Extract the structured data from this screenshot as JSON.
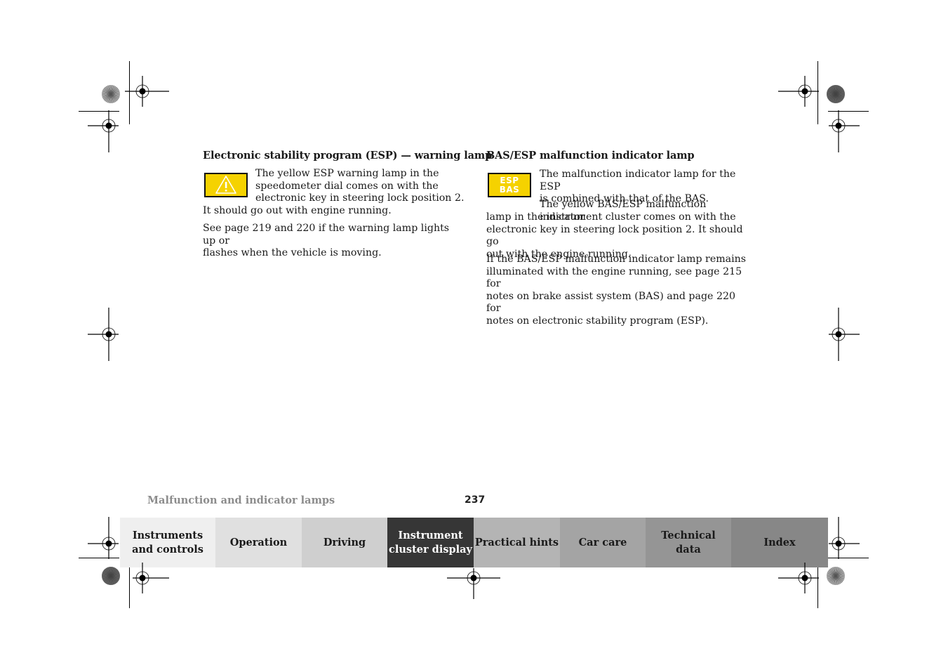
{
  "left_section": {
    "heading": "Electronic stability program (ESP) — warning lamp",
    "icon": "warning-triangle-icon",
    "lines_beside_icon": [
      "The yellow ESP warning lamp in the",
      "speedometer dial comes on with the",
      "electronic key in steering lock position 2."
    ],
    "line_after_icon": "It should go out with engine running.",
    "paragraph2": [
      "See page 219 and 220 if the warning lamp lights up or",
      "flashes when the vehicle is moving."
    ]
  },
  "right_section": {
    "heading": "BAS/ESP malfunction indicator lamp",
    "icon": "esp-bas-lamp-icon",
    "icon_text": [
      "ESP",
      "BAS"
    ],
    "lines_beside_icon": [
      "The malfunction indicator lamp for the ESP",
      "is combined with that of the BAS."
    ],
    "paragraph2": [
      "The yellow BAS/ESP malfunction indicator",
      "lamp in the instrument cluster comes on with the",
      "electronic key in steering lock position 2. It should go",
      "out with the engine running."
    ],
    "paragraph3": [
      "If the BAS/ESP malfunction indicator lamp remains",
      "illuminated with the engine running, see page 215 for",
      "notes on brake assist system (BAS) and page 220 for",
      "notes on electronic stability program (ESP)."
    ]
  },
  "footer": {
    "section_title": "Malfunction and indicator lamps",
    "page_number": "237"
  },
  "nav_tabs": [
    {
      "line1": "Instruments",
      "line2": "and controls",
      "color": "#efefef",
      "active": false
    },
    {
      "line1": "Operation",
      "line2": "",
      "color": "#e0e0e0",
      "active": false
    },
    {
      "line1": "Driving",
      "line2": "",
      "color": "#cfcfcf",
      "active": false
    },
    {
      "line1": "Instrument",
      "line2": "cluster display",
      "color": "#363636",
      "active": true
    },
    {
      "line1": "Practical hints",
      "line2": "",
      "color": "#b4b4b4",
      "active": false
    },
    {
      "line1": "Car care",
      "line2": "",
      "color": "#a4a4a4",
      "active": false
    },
    {
      "line1": "Technical",
      "line2": "data",
      "color": "#959595",
      "active": false
    },
    {
      "line1": "Index",
      "line2": "",
      "color": "#878787",
      "active": false
    }
  ],
  "colors": {
    "lamp_yellow": "#f5d200",
    "active_tab_text": "#ffffff",
    "footer_title": "#8c8c8c"
  }
}
